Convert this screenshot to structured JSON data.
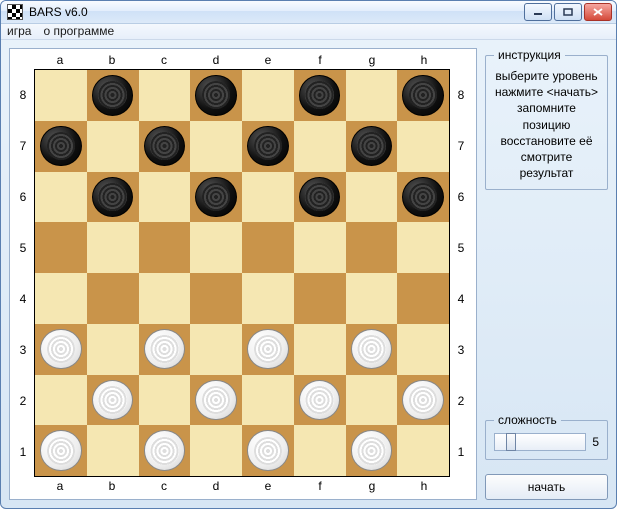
{
  "window": {
    "title": "BARS v6.0"
  },
  "menu": {
    "game": "игра",
    "about": "о программе"
  },
  "board": {
    "files": [
      "a",
      "b",
      "c",
      "d",
      "e",
      "f",
      "g",
      "h"
    ],
    "ranks": [
      "8",
      "7",
      "6",
      "5",
      "4",
      "3",
      "2",
      "1"
    ],
    "pieces": [
      {
        "file": "b",
        "rank": "8",
        "color": "black"
      },
      {
        "file": "d",
        "rank": "8",
        "color": "black"
      },
      {
        "file": "f",
        "rank": "8",
        "color": "black"
      },
      {
        "file": "h",
        "rank": "8",
        "color": "black"
      },
      {
        "file": "a",
        "rank": "7",
        "color": "black"
      },
      {
        "file": "c",
        "rank": "7",
        "color": "black"
      },
      {
        "file": "e",
        "rank": "7",
        "color": "black"
      },
      {
        "file": "g",
        "rank": "7",
        "color": "black"
      },
      {
        "file": "b",
        "rank": "6",
        "color": "black"
      },
      {
        "file": "d",
        "rank": "6",
        "color": "black"
      },
      {
        "file": "f",
        "rank": "6",
        "color": "black"
      },
      {
        "file": "h",
        "rank": "6",
        "color": "black"
      },
      {
        "file": "a",
        "rank": "3",
        "color": "white"
      },
      {
        "file": "c",
        "rank": "3",
        "color": "white"
      },
      {
        "file": "e",
        "rank": "3",
        "color": "white"
      },
      {
        "file": "g",
        "rank": "3",
        "color": "white"
      },
      {
        "file": "b",
        "rank": "2",
        "color": "white"
      },
      {
        "file": "d",
        "rank": "2",
        "color": "white"
      },
      {
        "file": "f",
        "rank": "2",
        "color": "white"
      },
      {
        "file": "h",
        "rank": "2",
        "color": "white"
      },
      {
        "file": "a",
        "rank": "1",
        "color": "white"
      },
      {
        "file": "c",
        "rank": "1",
        "color": "white"
      },
      {
        "file": "e",
        "rank": "1",
        "color": "white"
      },
      {
        "file": "g",
        "rank": "1",
        "color": "white"
      }
    ]
  },
  "instructions": {
    "legend": "инструкция",
    "lines": [
      "выберите уровень",
      "нажмите <начать>",
      "запомните позицию",
      "восстановите её",
      "смотрите результат"
    ]
  },
  "difficulty": {
    "legend": "сложность",
    "value": 5,
    "min": 1,
    "max": 20,
    "thumb_percent": 12
  },
  "start_label": "начать"
}
